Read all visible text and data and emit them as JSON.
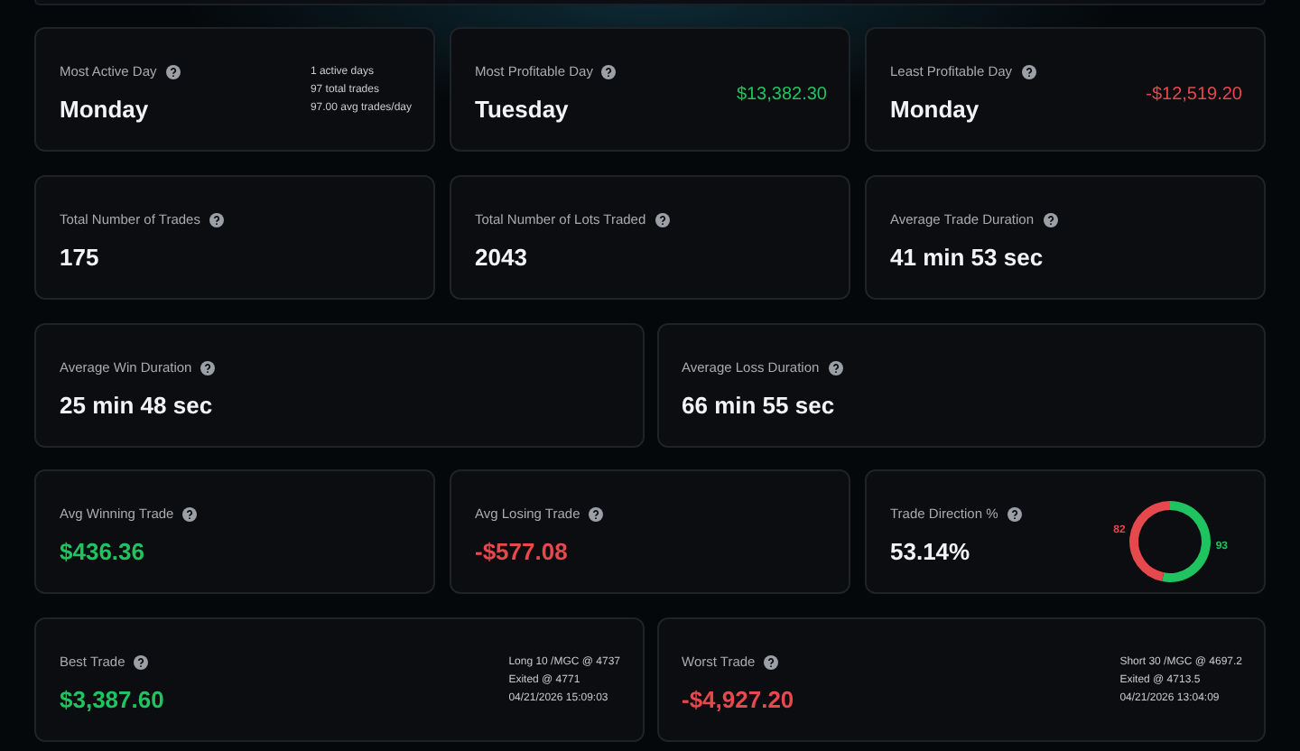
{
  "rows": [
    {
      "cards": [
        {
          "title": "Most Active Day",
          "value": "Monday",
          "details": [
            "1 active days",
            "97 total trades",
            "97.00 avg trades/day"
          ]
        },
        {
          "title": "Most Profitable Day",
          "value": "Tuesday",
          "side_value": {
            "text": "$13,382.30",
            "color": "#1fc35f"
          }
        },
        {
          "title": "Least Profitable Day",
          "value": "Monday",
          "side_value": {
            "text": "-$12,519.20",
            "color": "#e5484d"
          }
        }
      ]
    },
    {
      "cards": [
        {
          "title": "Total Number of Trades",
          "value": "175"
        },
        {
          "title": "Total Number of Lots Traded",
          "value": "2043"
        },
        {
          "title": "Average Trade Duration",
          "value": "41 min 53 sec"
        }
      ]
    },
    {
      "cards": [
        {
          "title": "Average Win Duration",
          "value": "25 min 48 sec"
        },
        {
          "title": "Average Loss Duration",
          "value": "66 min 55 sec"
        }
      ]
    },
    {
      "cards": [
        {
          "title": "Avg Winning Trade",
          "value": "$436.36",
          "color": "#1fc35f"
        },
        {
          "title": "Avg Losing Trade",
          "value": "-$577.08",
          "color": "#e5484d"
        },
        {
          "title": "Trade Direction %",
          "value": "53.14%",
          "chart_data": {
            "type": "donut",
            "values": [
              82,
              93
            ],
            "data_labels": true
          }
        }
      ]
    },
    {
      "cards": [
        {
          "title": "Best Trade",
          "value": "$3,387.60",
          "color": "#1fc35f",
          "details": [
            "Long 10 /MGC @ 4737",
            "Exited @ 4771",
            "04/21/2026 15:09:03"
          ]
        },
        {
          "title": "Worst Trade",
          "value": "-$4,927.20",
          "color": "#e5484d",
          "details": [
            "Short 30 /MGC @ 4697.2",
            "Exited @ 4713.5",
            "04/21/2026 13:04:09"
          ]
        }
      ]
    }
  ]
}
